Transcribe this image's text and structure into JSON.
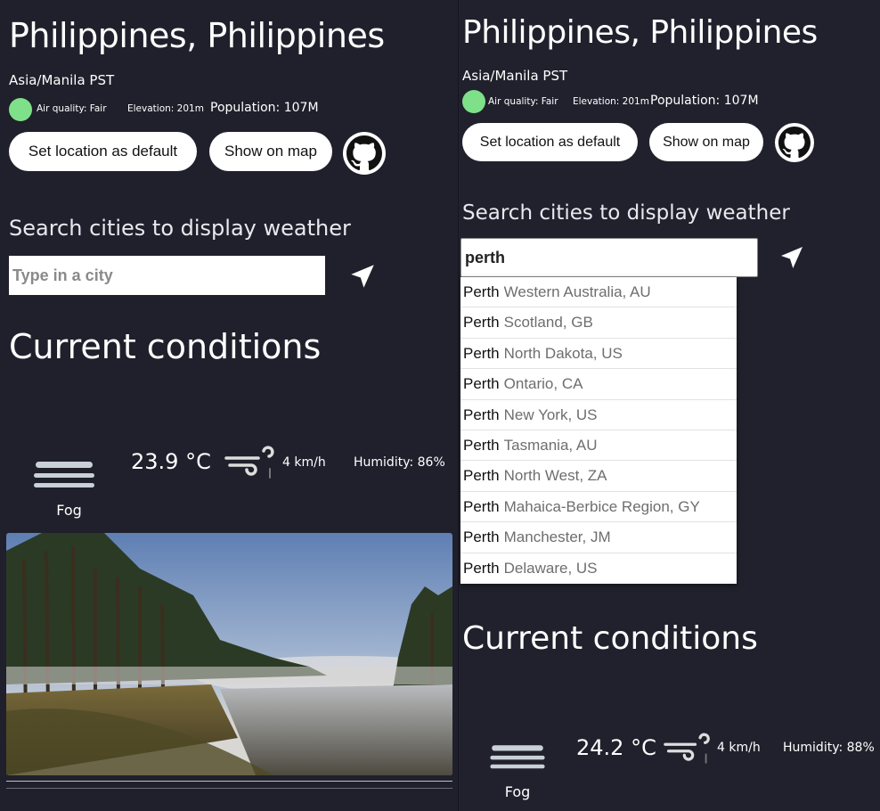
{
  "left": {
    "city": "Philippines, Philippines",
    "timezone": "Asia/Manila PST",
    "air_quality": "Air quality: Fair",
    "elevation": "Elevation: 201m",
    "population": "Population: 107M",
    "set_default_label": "Set location as default",
    "show_map_label": "Show on map",
    "search_heading": "Search cities to display weather",
    "search_placeholder": "Type in a city",
    "conditions_heading": "Current conditions",
    "temperature": "23.9 °C",
    "wind": "4 km/h",
    "humidity": "Humidity: 86%",
    "weather_label": "Fog"
  },
  "right": {
    "city": "Philippines, Philippines",
    "timezone": "Asia/Manila PST",
    "air_quality": "Air quality: Fair",
    "elevation": "Elevation: 201m",
    "population": "Population: 107M",
    "set_default_label": "Set location as default",
    "show_map_label": "Show on map",
    "search_heading": "Search cities to display weather",
    "search_value": "perth",
    "suggestions": [
      {
        "city": "Perth",
        "region": "Western Australia, AU"
      },
      {
        "city": "Perth",
        "region": "Scotland, GB"
      },
      {
        "city": "Perth",
        "region": "North Dakota, US"
      },
      {
        "city": "Perth",
        "region": "Ontario, CA"
      },
      {
        "city": "Perth",
        "region": "New York, US"
      },
      {
        "city": "Perth",
        "region": "Tasmania, AU"
      },
      {
        "city": "Perth",
        "region": "North West, ZA"
      },
      {
        "city": "Perth",
        "region": "Mahaica-Berbice Region, GY"
      },
      {
        "city": "Perth",
        "region": "Manchester, JM"
      },
      {
        "city": "Perth",
        "region": "Delaware, US"
      }
    ],
    "conditions_heading": "Current conditions",
    "temperature": "24.2 °C",
    "wind": "4 km/h",
    "humidity": "Humidity: 88%",
    "weather_label": "Fog"
  },
  "icons": {
    "github": "github-icon",
    "location": "location-arrow-icon",
    "fog": "fog-moon-icon",
    "wind": "wind-icon"
  },
  "colors": {
    "background": "#1f202b",
    "air_quality_fair": "#7fe08a",
    "weather_icon": "#7ec3ea"
  }
}
